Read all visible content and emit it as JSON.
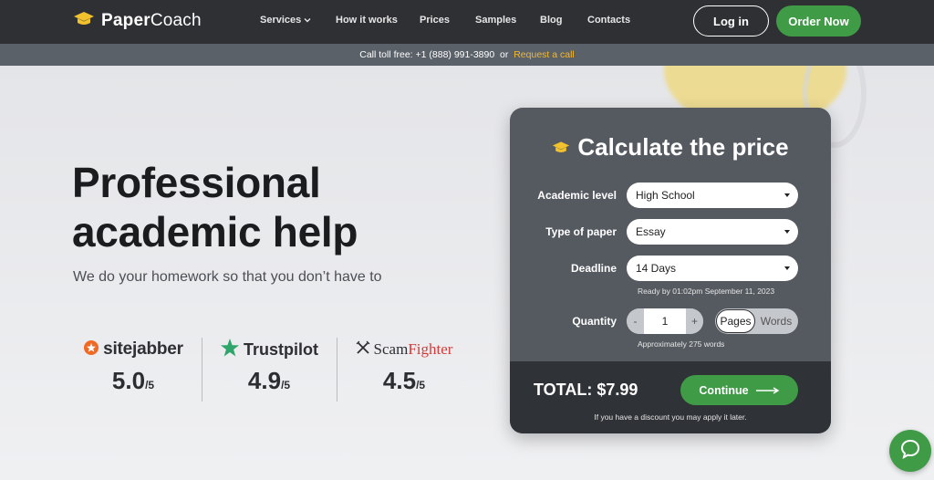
{
  "header": {
    "logo_bold": "Paper",
    "logo_regular": "Coach",
    "nav": [
      "Services",
      "How it works",
      "Prices",
      "Samples",
      "Blog",
      "Contacts"
    ],
    "login_label": "Log in",
    "order_label": "Order Now"
  },
  "subbar": {
    "text": "Call toll free: +1 (888) 991-3890  or  ",
    "link": "Request a call"
  },
  "hero": {
    "title_line1": "Professional",
    "title_line2": "academic help",
    "subtitle": "We do your homework so that you don’t have to"
  },
  "ratings": [
    {
      "brand": "sitejabber",
      "score": "5.0",
      "scale": "/5"
    },
    {
      "brand": "Trustpilot",
      "score": "4.9",
      "scale": "/5"
    },
    {
      "brand_a": "Scam",
      "brand_b": "Fighter",
      "score": "4.5",
      "scale": "/5"
    }
  ],
  "calculator": {
    "title": "Calculate the price",
    "academic_level_label": "Academic level",
    "academic_level_value": "High School",
    "paper_type_label": "Type of paper",
    "paper_type_value": "Essay",
    "deadline_label": "Deadline",
    "deadline_value": "14 Days",
    "deadline_note": "Ready by 01:02pm September 11, 2023",
    "quantity_label": "Quantity",
    "quantity_value": "1",
    "minus": "-",
    "plus": "+",
    "unit_pages": "Pages",
    "unit_words": "Words",
    "words_note": "Approximately 275 words",
    "total": "TOTAL: $7.99",
    "continue_label": "Continue",
    "discount_note": "If you have a discount you may apply it later."
  },
  "colors": {
    "accent_green": "#3f9b46",
    "header_bg": "#2e3033",
    "link_yellow": "#f5b82e",
    "card_bg": "#555a60"
  },
  "icons": [
    "graduation-cap-icon",
    "chevron-down-icon",
    "sitejabber-icon",
    "trustpilot-star-icon",
    "scamfighter-icon",
    "arrow-right-icon",
    "chat-icon"
  ]
}
